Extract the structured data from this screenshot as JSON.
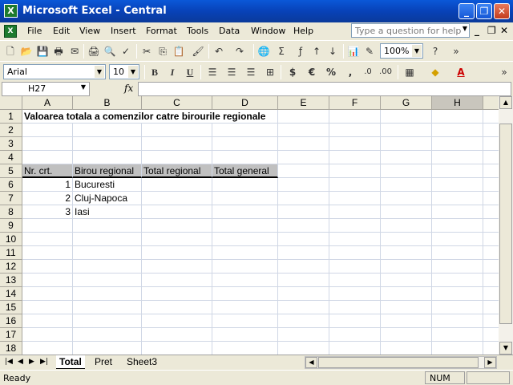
{
  "window": {
    "title": "Microsoft Excel - Central",
    "icon": "excel-icon"
  },
  "menu": {
    "items": [
      "File",
      "Edit",
      "View",
      "Insert",
      "Format",
      "Tools",
      "Data",
      "Window",
      "Help"
    ],
    "help_placeholder": "Type a question for help"
  },
  "toolbar": {
    "zoom": "100%",
    "font": "Arial",
    "font_size": "10",
    "bold": "B",
    "italic": "I",
    "underline": "U",
    "currency": "$",
    "euro": "€",
    "percent": "%",
    "comma": ","
  },
  "formula": {
    "name_box": "H27",
    "fx": "fx",
    "value": ""
  },
  "grid": {
    "columns": [
      "A",
      "B",
      "C",
      "D",
      "E",
      "F",
      "G",
      "H"
    ],
    "active_column": "H",
    "rows": [
      "1",
      "2",
      "3",
      "4",
      "5",
      "6",
      "7",
      "8",
      "9",
      "10",
      "11",
      "12",
      "13",
      "14",
      "15",
      "16",
      "17",
      "18"
    ],
    "title": "Valoarea totala a comenzilor catre birourile regionale",
    "headers": [
      "Nr. crt.",
      "Birou regional",
      "Total regional",
      "Total general"
    ],
    "data": [
      {
        "nr": "1",
        "birou": "Bucuresti"
      },
      {
        "nr": "2",
        "birou": "Cluj-Napoca"
      },
      {
        "nr": "3",
        "birou": "Iasi"
      }
    ]
  },
  "sheets": {
    "tabs": [
      "Total",
      "Pret",
      "Sheet3"
    ],
    "active": "Total"
  },
  "status": {
    "text": "Ready",
    "num": "NUM"
  }
}
